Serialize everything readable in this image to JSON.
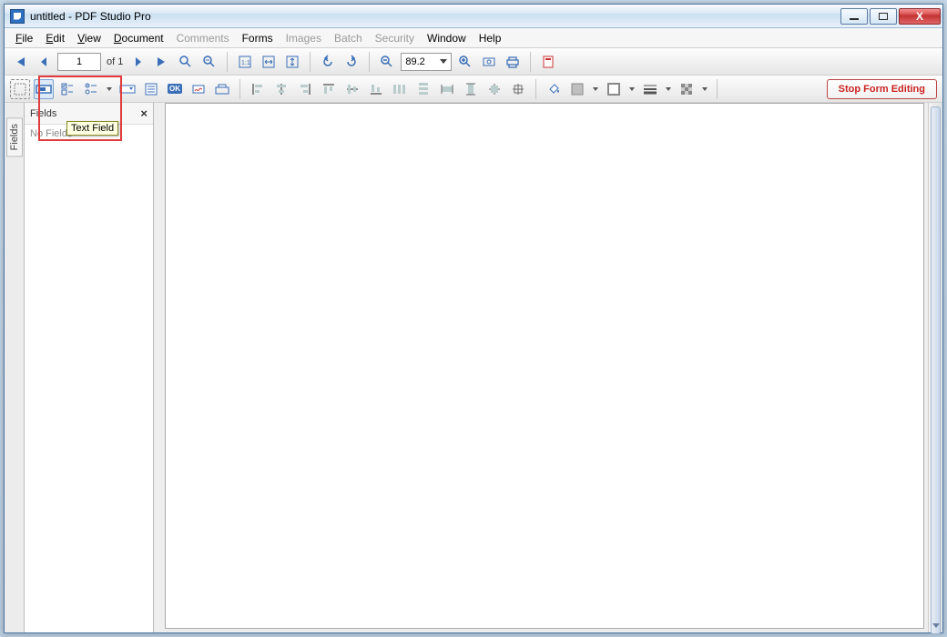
{
  "window": {
    "title": "untitled - PDF Studio Pro"
  },
  "win_buttons": {
    "minimize": "–",
    "maximize": "▢",
    "close": "X"
  },
  "menu": {
    "file": {
      "label": "File",
      "ul": "F"
    },
    "edit": {
      "label": "Edit",
      "ul": "E"
    },
    "view": {
      "label": "View",
      "ul": "V"
    },
    "document": {
      "label": "Document",
      "ul": "D"
    },
    "comments": {
      "label": "Comments"
    },
    "forms": {
      "label": "Forms"
    },
    "images": {
      "label": "Images"
    },
    "batch": {
      "label": "Batch"
    },
    "security": {
      "label": "Security"
    },
    "windowm": {
      "label": "Window"
    },
    "help": {
      "label": "Help"
    }
  },
  "nav": {
    "page_current": "1",
    "page_of": "of 1",
    "zoom_value": "89.2"
  },
  "toolbar2": {
    "ok_label": "OK",
    "stop_form": "Stop Form Editing"
  },
  "sidebar": {
    "tab_label": "Fields",
    "panel_title": "Fields",
    "panel_close": "×",
    "empty_text": "No Fields"
  },
  "tooltip": {
    "text_field": "Text Field"
  },
  "icons": {
    "first": "first-page",
    "prev": "prev-page",
    "next": "next-page",
    "last": "last-page",
    "zoom_tool": "zoom-tool",
    "zoom_area": "zoom-area",
    "actual": "actual-size",
    "fit_w": "fit-width",
    "fit_p": "fit-page",
    "rot_ccw": "rotate-ccw",
    "rot_cw": "rotate-cw",
    "zoom_out": "zoom-out",
    "zoom_in": "zoom-in",
    "snap": "snapshot",
    "print": "print",
    "settings": "settings",
    "f_text": "text-field",
    "f_check": "checkbox-field",
    "f_radio": "radio-field",
    "f_combo": "combo-field",
    "f_list": "list-field",
    "f_btn": "button-field",
    "f_sig": "signature-field",
    "typewriter": "typewriter",
    "al_l": "align-left",
    "al_ch": "align-center-h",
    "al_r": "align-right",
    "al_t": "align-top",
    "al_cv": "align-center-v",
    "al_b": "align-bottom",
    "dist_h": "distribute-horiz",
    "dist_v": "distribute-vert",
    "same_w": "same-width",
    "same_h": "same-height",
    "same_b": "same-both",
    "center": "center-page",
    "fill": "fill-color",
    "line": "line-color",
    "weight": "line-weight",
    "style": "line-style"
  }
}
